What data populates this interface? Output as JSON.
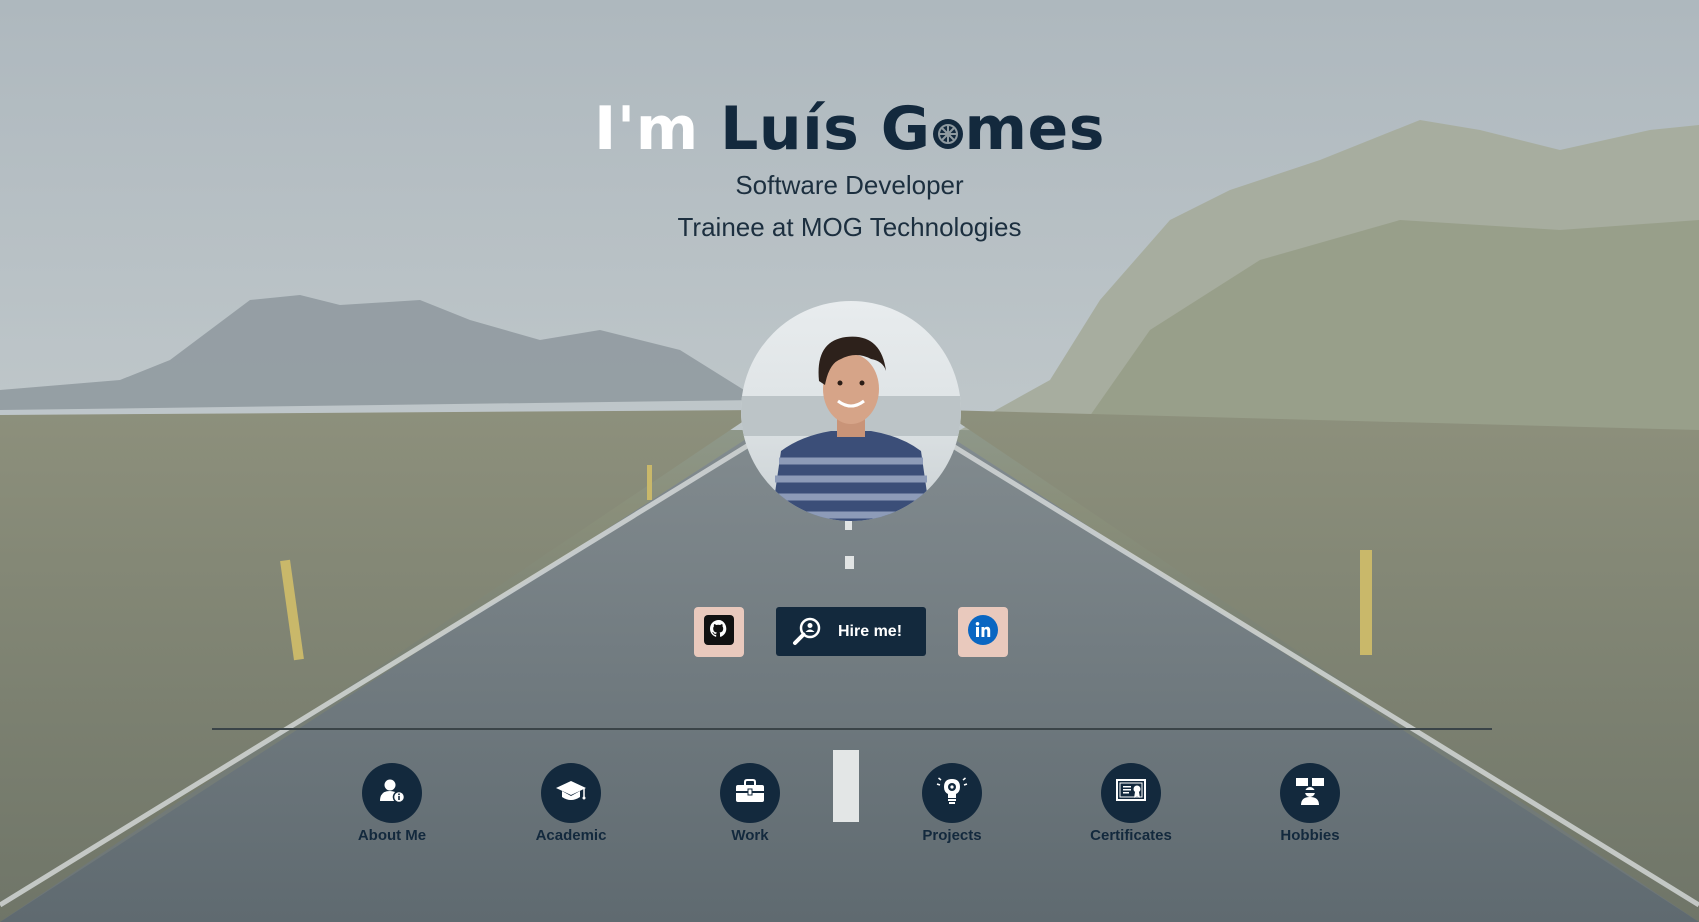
{
  "hero": {
    "title_prefix": "I'm",
    "title_name_start": "Luís G",
    "title_name_end": "mes",
    "subtitle_line1": "Software Developer",
    "subtitle_line2": "Trainee at MOG Technologies"
  },
  "social": {
    "github_icon": "github-icon",
    "linkedin_icon": "linkedin-icon",
    "hire_label": "Hire me!",
    "hire_icon": "search-person-icon"
  },
  "nav": {
    "items": [
      {
        "label": "About Me",
        "icon": "user-info-icon"
      },
      {
        "label": "Academic",
        "icon": "graduation-cap-icon"
      },
      {
        "label": "Work",
        "icon": "briefcase-icon"
      },
      {
        "label": "Projects",
        "icon": "lightbulb-gear-icon"
      },
      {
        "label": "Certificates",
        "icon": "certificate-icon"
      },
      {
        "label": "Hobbies",
        "icon": "hobbies-icon"
      }
    ]
  },
  "colors": {
    "navy": "#13293d",
    "button_light": "#e9c9bd",
    "linkedin": "#0a66c2"
  }
}
